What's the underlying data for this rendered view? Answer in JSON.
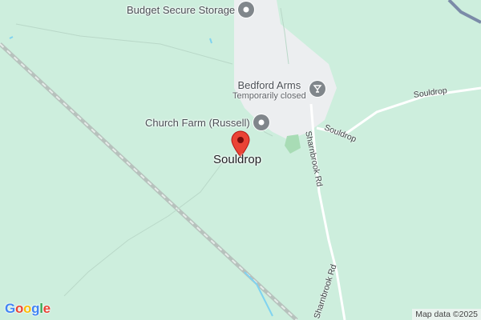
{
  "map": {
    "place_label": "Souldrop",
    "pois": [
      {
        "label": "Budget Secure Storage",
        "icon": "pin-icon"
      },
      {
        "label": "Bedford Arms",
        "sublabel": "Temporarily closed",
        "icon": "cocktail-icon"
      },
      {
        "label": "Church Farm (Russell)",
        "icon": "pin-icon"
      }
    ],
    "roads": {
      "souldrop_east": "Souldrop",
      "souldrop_mid": "Souldrop",
      "sharnbrook_upper": "Sharnbrook Rd",
      "sharnbrook_lower": "Sharnbrook Rd"
    },
    "attribution": "Map data ©2025",
    "logo": [
      "G",
      "o",
      "o",
      "g",
      "l",
      "e"
    ]
  },
  "colors": {
    "land": "#cdeedd",
    "urban": "#eceef0",
    "pin": "#ea4335",
    "water": "#7fd3f0"
  }
}
